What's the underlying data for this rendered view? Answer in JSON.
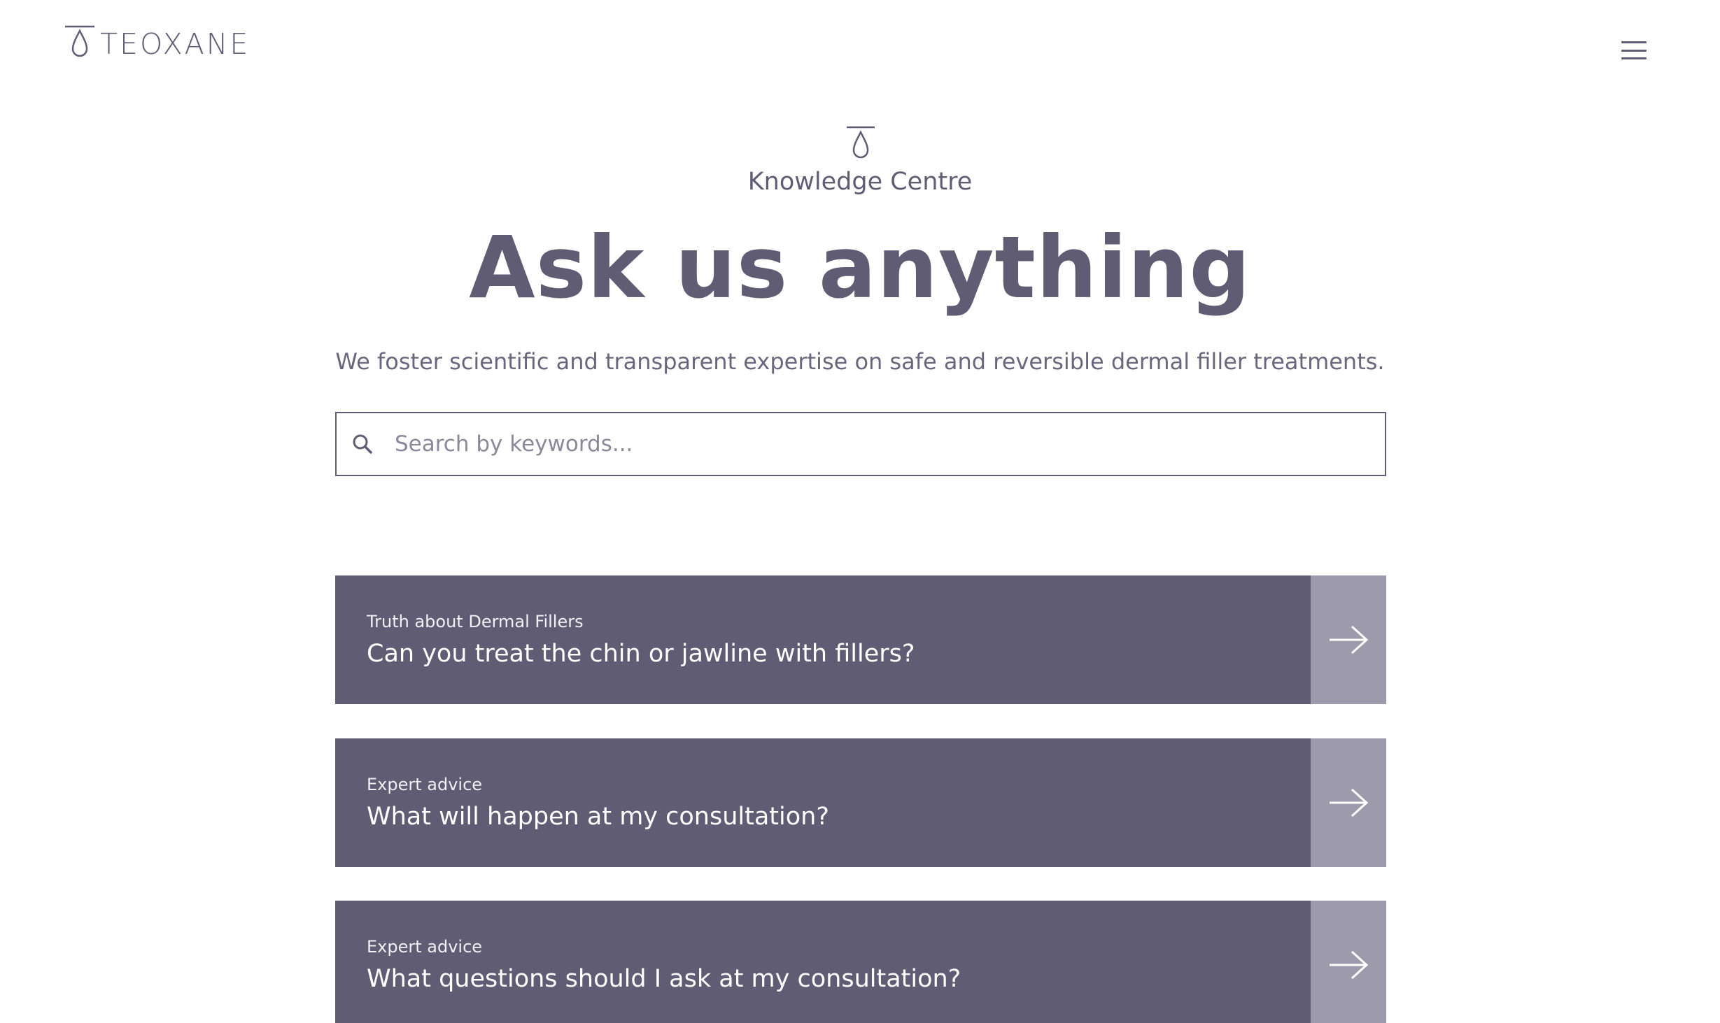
{
  "brand": {
    "name": "TEOXANE"
  },
  "header": {
    "menu_icon": "hamburger-menu-icon"
  },
  "hero": {
    "section_label": "Knowledge Centre",
    "title": "Ask us anything",
    "subtitle": "We foster scientific and transparent expertise on safe and reversible dermal filler treatments."
  },
  "search": {
    "placeholder": "Search by keywords...",
    "value": "",
    "icon": "search-icon"
  },
  "cards": [
    {
      "category": "Truth about Dermal Fillers",
      "question": "Can you treat the chin or jawline with fillers?"
    },
    {
      "category": "Expert advice",
      "question": "What will happen at my consultation?"
    },
    {
      "category": "Expert advice",
      "question": "What questions should I ask at my consultation?"
    }
  ],
  "colors": {
    "brand": "#5f5c73",
    "card_bg": "#5f5c73",
    "arrow_bg": "#9d9aac",
    "background": "#ffffff"
  }
}
